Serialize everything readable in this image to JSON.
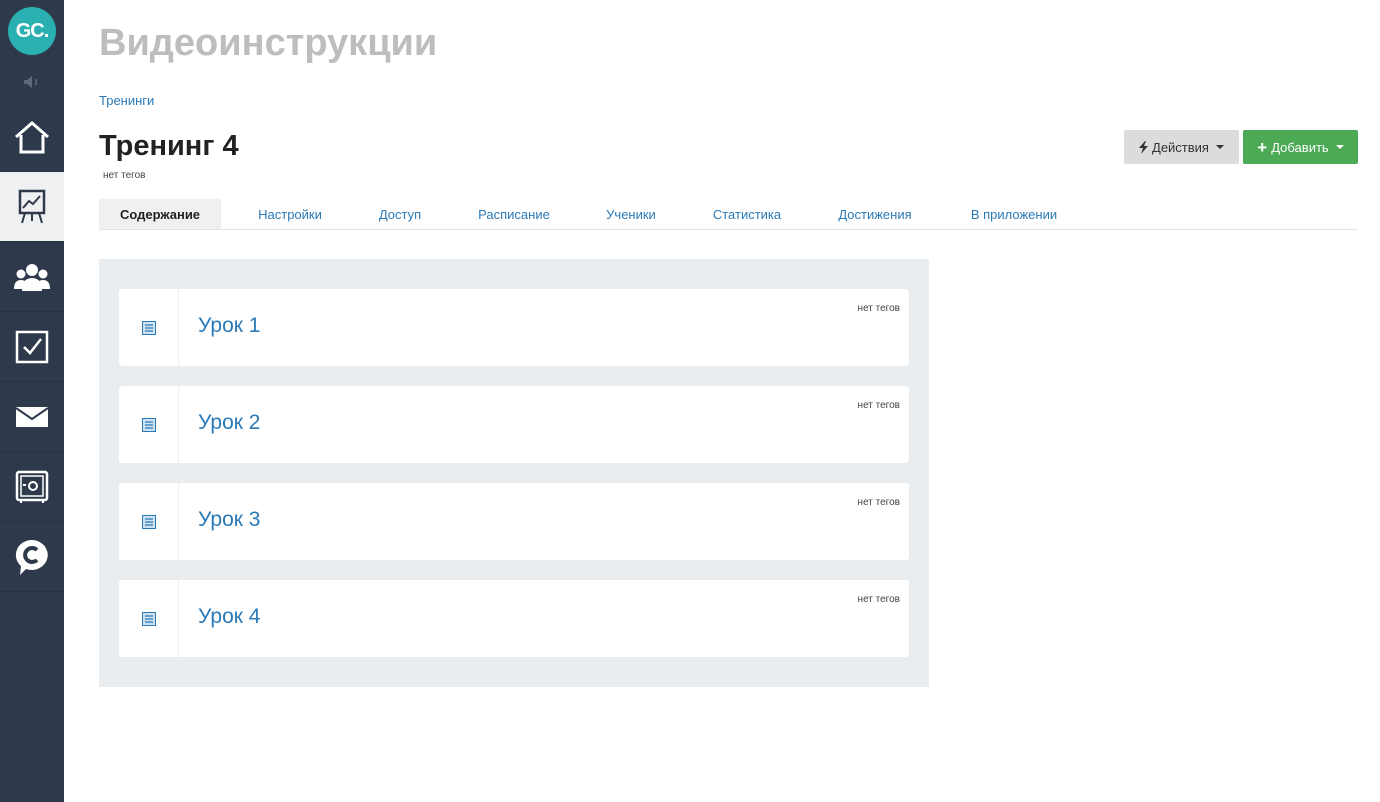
{
  "sidebar": {
    "logo_text": "GC.",
    "items": [
      {
        "icon": "home-icon"
      },
      {
        "icon": "training-board-icon",
        "active": true
      },
      {
        "icon": "users-icon"
      },
      {
        "icon": "tasks-checkbox-icon"
      },
      {
        "icon": "mail-icon"
      },
      {
        "icon": "safe-icon"
      },
      {
        "icon": "chat-c-icon"
      }
    ]
  },
  "page": {
    "title": "Видеоинструкции",
    "breadcrumb": "Тренинги"
  },
  "training": {
    "title": "Тренинг 4",
    "tags": "нет тегов"
  },
  "toolbar": {
    "actions_label": "Действия",
    "add_label": "Добавить"
  },
  "tabs": [
    {
      "label": "Содержание",
      "active": true
    },
    {
      "label": "Настройки"
    },
    {
      "label": "Доступ"
    },
    {
      "label": "Расписание"
    },
    {
      "label": "Ученики"
    },
    {
      "label": "Статистика"
    },
    {
      "label": "Достижения"
    },
    {
      "label": "В приложении"
    }
  ],
  "lessons": [
    {
      "title": "Урок 1",
      "tags": "нет тегов"
    },
    {
      "title": "Урок 2",
      "tags": "нет тегов"
    },
    {
      "title": "Урок 3",
      "tags": "нет тегов"
    },
    {
      "title": "Урок 4",
      "tags": "нет тегов"
    }
  ],
  "colors": {
    "sidebar_bg": "#2e3a4b",
    "logo": "#2ab0b0",
    "link": "#2a7ab8",
    "add_button": "#4caa57",
    "actions_button": "#dcdcdc"
  }
}
